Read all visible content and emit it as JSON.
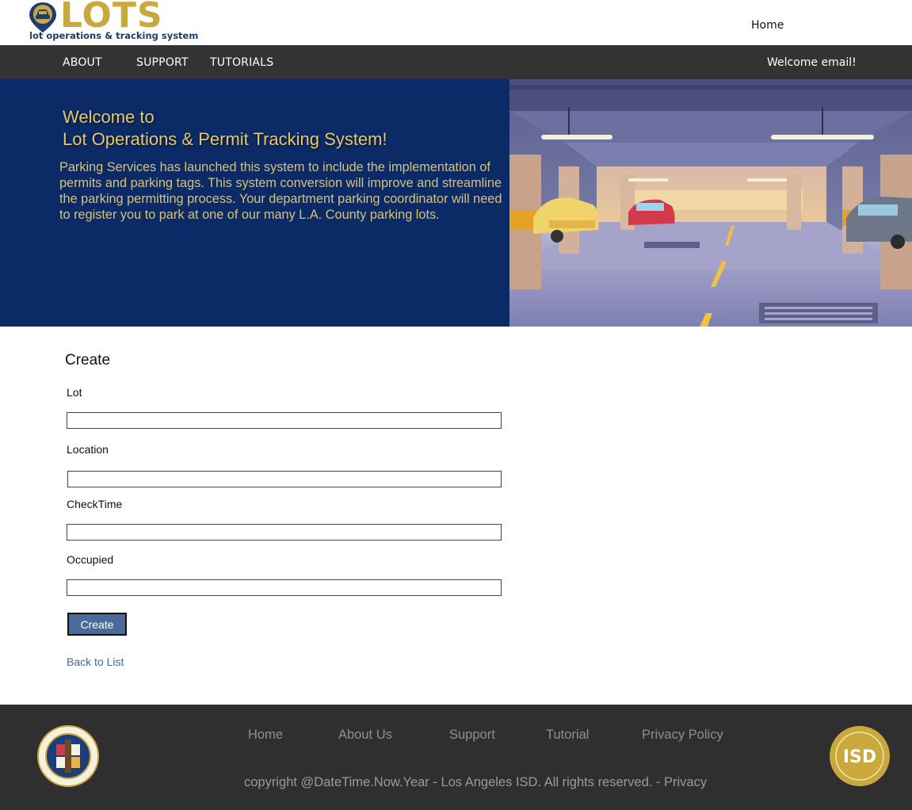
{
  "logo": {
    "wordmark": "LOTS",
    "tagline": "lot operations & tracking system"
  },
  "header": {
    "home_label": "Home"
  },
  "nav": {
    "items": [
      {
        "label": "ABOUT"
      },
      {
        "label": "SUPPORT"
      },
      {
        "label": "TUTORIALS"
      }
    ],
    "welcome": "Welcome email!"
  },
  "hero": {
    "title_line1": "Welcome to",
    "title_line2": "Lot Operations & Permit Tracking System!",
    "body": "Parking Services has launched this system to include the implementation of permits and parking tags. This system conversion will improve and streamline the parking permitting process. Your department parking coordinator will need to register you to park at one of our many L.A. County parking lots."
  },
  "form": {
    "title": "Create",
    "fields": [
      {
        "label": "Lot",
        "value": ""
      },
      {
        "label": "Location",
        "value": ""
      },
      {
        "label": "CheckTime",
        "value": ""
      },
      {
        "label": "Occupied",
        "value": ""
      }
    ],
    "submit_label": "Create",
    "back_label": "Back to List"
  },
  "footer": {
    "links": [
      {
        "label": "Home"
      },
      {
        "label": "About Us"
      },
      {
        "label": "Support"
      },
      {
        "label": "Tutorial"
      },
      {
        "label": "Privacy Policy"
      }
    ],
    "copyright": "copyright @DateTime.Now.Year - Los Angeles ISD. All rights reserved. - Privacy"
  },
  "colors": {
    "navbar_bg": "#353233",
    "hero_bg": "#0b2a66",
    "hero_text": "#d9c270",
    "logo_gold": "#c9a93d",
    "button_bg": "#4a6b9a",
    "link": "#3c6a9d",
    "footer_bg": "#2f2f2f"
  }
}
